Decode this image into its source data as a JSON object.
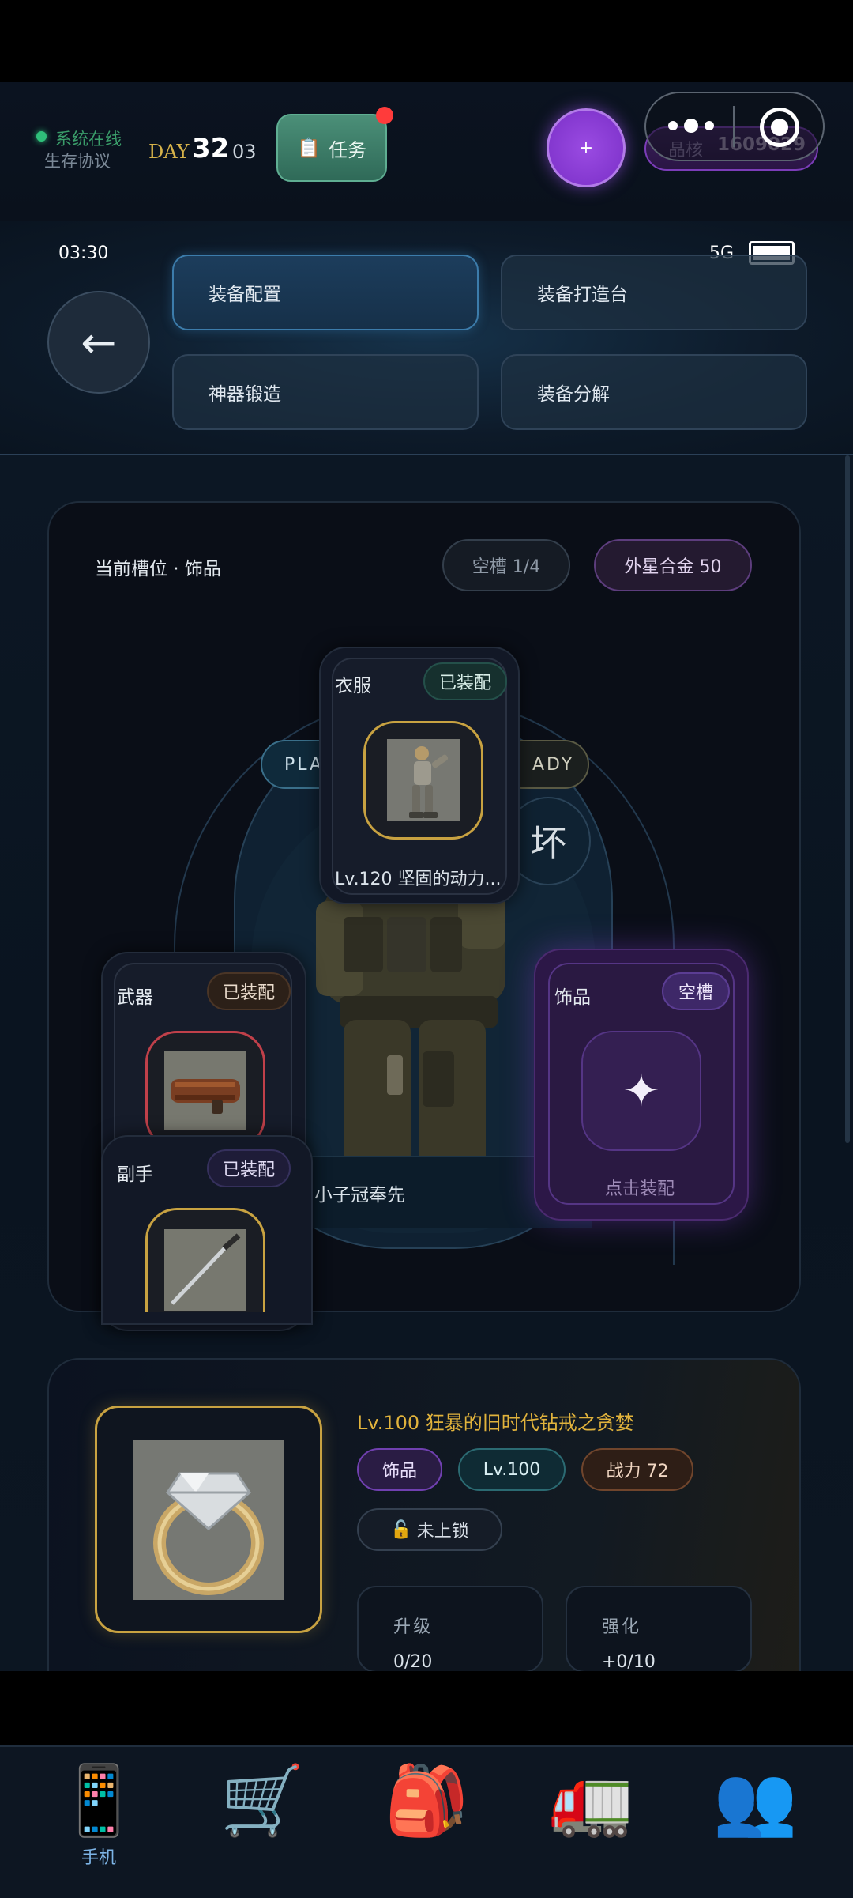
{
  "header": {
    "status_online": "系统在线",
    "protocol": "生存协议",
    "day_label": "DAY",
    "day_number": "32",
    "day_sub": "03",
    "task_icon": "📋",
    "task_label": "任务",
    "plus_label": "+",
    "core_label": "晶核",
    "core_value": "1609029"
  },
  "status_bar": {
    "time": "03:30",
    "network": "5G"
  },
  "nav": {
    "back_arrow": "←",
    "buttons": [
      {
        "label": "装备配置",
        "active": true
      },
      {
        "label": "装备打造台",
        "active": false
      },
      {
        "label": "神器锻造",
        "active": false
      },
      {
        "label": "装备分解",
        "active": false
      }
    ]
  },
  "equipment": {
    "current_slot": "当前槽位 · 饰品",
    "empty_slots": "空槽 1/4",
    "alloy": "外星合金 50",
    "player_tag": "PLA",
    "ready_tag": "ADY",
    "bad_mark": "坏",
    "character_name": "小子冠奉先",
    "slots": {
      "clothes": {
        "label": "衣服",
        "status": "已装配",
        "item": "Lv.120 坚固的动力..."
      },
      "weapon": {
        "label": "武器",
        "status": "已装配"
      },
      "offhand": {
        "label": "副手",
        "status": "已装配"
      },
      "accessory": {
        "label": "饰品",
        "status": "空槽",
        "action": "点击装配",
        "icon": "✦"
      }
    }
  },
  "selected_item": {
    "name": "Lv.100 狂暴的旧时代钻戒之贪婪",
    "tags": {
      "type": "饰品",
      "level": "Lv.100",
      "power": "战力 72",
      "lock": "未上锁",
      "lock_icon": "🔓"
    },
    "stats": [
      {
        "title": "升级",
        "value": "0/20"
      },
      {
        "title": "强化",
        "value": "+0/10"
      }
    ]
  },
  "tabbar": {
    "tabs": [
      {
        "icon": "📱",
        "label": "手机",
        "active": true
      },
      {
        "icon": "🛒",
        "label": "",
        "active": false
      },
      {
        "icon": "🎒",
        "label": "",
        "active": false
      },
      {
        "icon": "🚛",
        "label": "",
        "active": false
      },
      {
        "icon": "👥",
        "label": "",
        "active": false
      }
    ]
  },
  "colors": {
    "accent_gold": "#e1b33c",
    "accent_purple": "#7a2fc7",
    "online_green": "#2fc07a",
    "notify_red": "#ff3b3b"
  }
}
